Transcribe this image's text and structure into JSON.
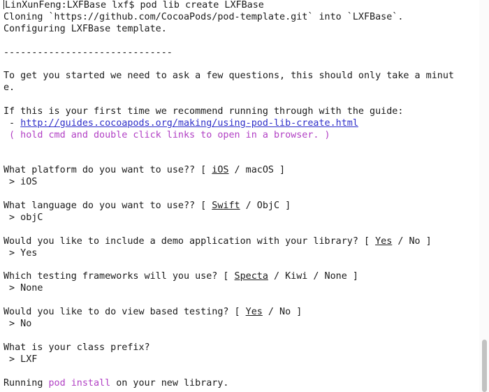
{
  "terminal": {
    "prompt": "LinXunFeng:LXFBase lxf$ pod lib create LXFBase",
    "cloning": "Cloning `https://github.com/CocoaPods/pod-template.git` into `LXFBase`.",
    "configuring": "Configuring LXFBase template.",
    "separator": "------------------------------",
    "intro_1": "To get you started we need to ask a few questions, this should only take a minut",
    "intro_2": "e.",
    "guide_intro": "If this is your first time we recommend running through with the guide:",
    "guide_dash": " - ",
    "guide_link": "http://guides.cocoapods.org/making/using-pod-lib-create.html",
    "guide_hint": " ( hold cmd and double click links to open in a browser. )",
    "q_platform": {
      "prefix": "What platform do you want to use?? [ ",
      "default": "iOS",
      "rest": " / macOS ]",
      "answer": " > iOS"
    },
    "q_language": {
      "prefix": "What language do you want to use?? [ ",
      "default": "Swift",
      "rest": " / ObjC ]",
      "answer": " > objC"
    },
    "q_demo": {
      "prefix": "Would you like to include a demo application with your library? [ ",
      "default": "Yes",
      "rest": " / No ]",
      "answer": " > Yes"
    },
    "q_testing": {
      "prefix": "Which testing frameworks will you use? [ ",
      "default": "Specta",
      "rest": " / Kiwi / None ]",
      "answer": " > None"
    },
    "q_viewtest": {
      "prefix": "Would you like to do view based testing? [ ",
      "default": "Yes",
      "rest": " / No ]",
      "answer": " > No"
    },
    "q_prefix": {
      "question": "What is your class prefix?",
      "answer": " > LXF"
    },
    "running": {
      "before": "Running ",
      "cmd": "pod install",
      "after": " on your new library."
    }
  },
  "colors": {
    "text": "#1a1a1a",
    "link": "#2f2fc9",
    "highlight": "#b13fc4",
    "background": "#ffffff"
  }
}
